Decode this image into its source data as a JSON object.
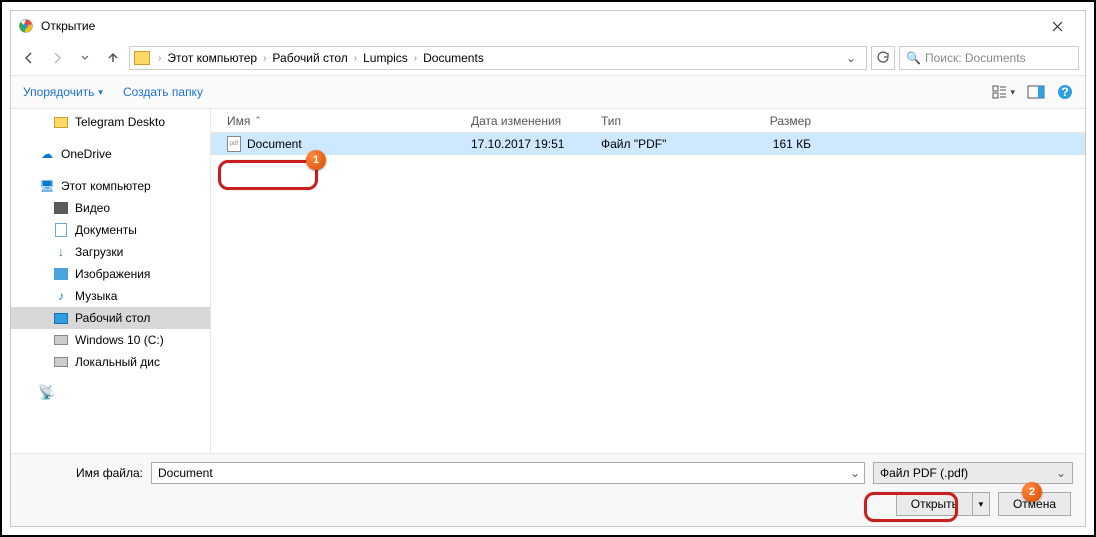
{
  "window": {
    "title": "Открытие"
  },
  "nav": {
    "crumbs": [
      "Этот компьютер",
      "Рабочий стол",
      "Lumpics",
      "Documents"
    ],
    "search_placeholder": "Поиск: Documents"
  },
  "toolbar": {
    "organize": "Упорядочить",
    "new_folder": "Создать папку"
  },
  "tree": {
    "items": [
      {
        "label": "Telegram Deskto",
        "icon": "folder",
        "level": 2
      },
      {
        "label": "OneDrive",
        "icon": "onedrive",
        "level": 1
      },
      {
        "label": "Этот компьютер",
        "icon": "pc",
        "level": 1
      },
      {
        "label": "Видео",
        "icon": "video",
        "level": 2
      },
      {
        "label": "Документы",
        "icon": "doc",
        "level": 2
      },
      {
        "label": "Загрузки",
        "icon": "down",
        "level": 2
      },
      {
        "label": "Изображения",
        "icon": "img",
        "level": 2
      },
      {
        "label": "Музыка",
        "icon": "music",
        "level": 2
      },
      {
        "label": "Рабочий стол",
        "icon": "desktop",
        "level": 2,
        "selected": true
      },
      {
        "label": "Windows 10 (C:)",
        "icon": "drive",
        "level": 2
      },
      {
        "label": "Локальный дис",
        "icon": "drive",
        "level": 2
      }
    ]
  },
  "columns": {
    "name": "Имя",
    "date": "Дата изменения",
    "type": "Тип",
    "size": "Размер"
  },
  "files": [
    {
      "name": "Document",
      "date": "17.10.2017 19:51",
      "type": "Файл \"PDF\"",
      "size": "161 КБ",
      "selected": true
    }
  ],
  "bottom": {
    "filename_label": "Имя файла:",
    "filename_value": "Document",
    "filter": "Файл PDF (.pdf)",
    "open": "Открыть",
    "cancel": "Отмена"
  },
  "badges": {
    "one": "1",
    "two": "2"
  }
}
